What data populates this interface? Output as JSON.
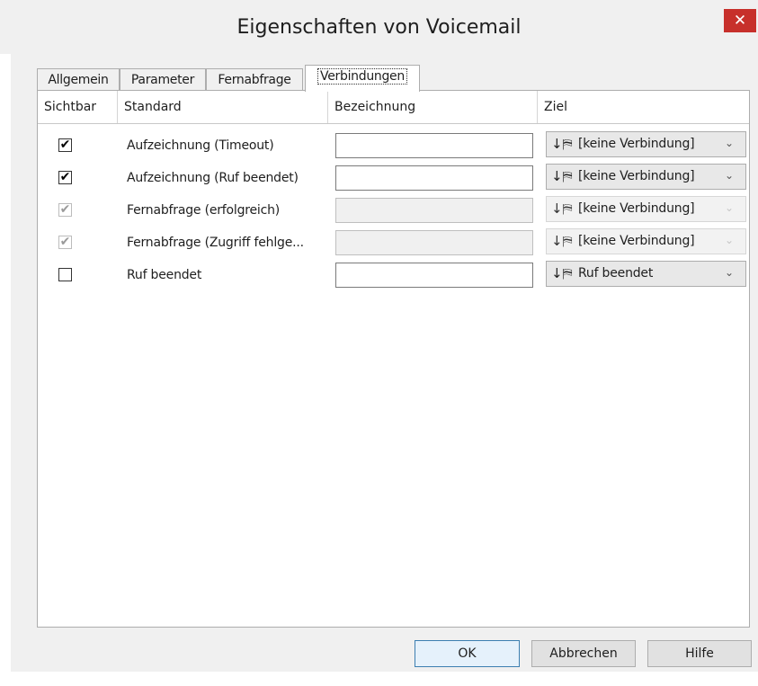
{
  "window": {
    "title": "Eigenschaften von Voicemail",
    "close_glyph": "✕"
  },
  "tabs": [
    {
      "label": "Allgemein",
      "active": false
    },
    {
      "label": "Parameter",
      "active": false
    },
    {
      "label": "Fernabfrage",
      "active": false
    },
    {
      "label": "Verbindungen",
      "active": true
    }
  ],
  "columns": {
    "sichtbar": "Sichtbar",
    "standard": "Standard",
    "bezeichnung": "Bezeichnung",
    "ziel": "Ziel"
  },
  "rows": [
    {
      "checked": true,
      "enabled": true,
      "standard": "Aufzeichnung (Timeout)",
      "bezeichnung": "",
      "ziel": "[keine Verbindung]",
      "ziel_enabled": true
    },
    {
      "checked": true,
      "enabled": true,
      "standard": "Aufzeichnung (Ruf beendet)",
      "bezeichnung": "",
      "ziel": "[keine Verbindung]",
      "ziel_enabled": true
    },
    {
      "checked": true,
      "enabled": false,
      "standard": "Fernabfrage (erfolgreich)",
      "bezeichnung": "",
      "ziel": "[keine Verbindung]",
      "ziel_enabled": false
    },
    {
      "checked": true,
      "enabled": false,
      "standard": "Fernabfrage (Zugriff fehlge...",
      "bezeichnung": "",
      "ziel": "[keine Verbindung]",
      "ziel_enabled": false
    },
    {
      "checked": false,
      "enabled": true,
      "standard": "Ruf beendet",
      "bezeichnung": "",
      "ziel": "Ruf beendet",
      "ziel_enabled": true
    }
  ],
  "icons": {
    "checkmark": "✔",
    "ziel_icon": "↓⛿",
    "chevron": "⌄"
  },
  "buttons": {
    "ok": "OK",
    "cancel": "Abbrechen",
    "help": "Hilfe"
  },
  "colors": {
    "close_button": "#c7302b",
    "default_button_border": "#3c7fb1"
  }
}
